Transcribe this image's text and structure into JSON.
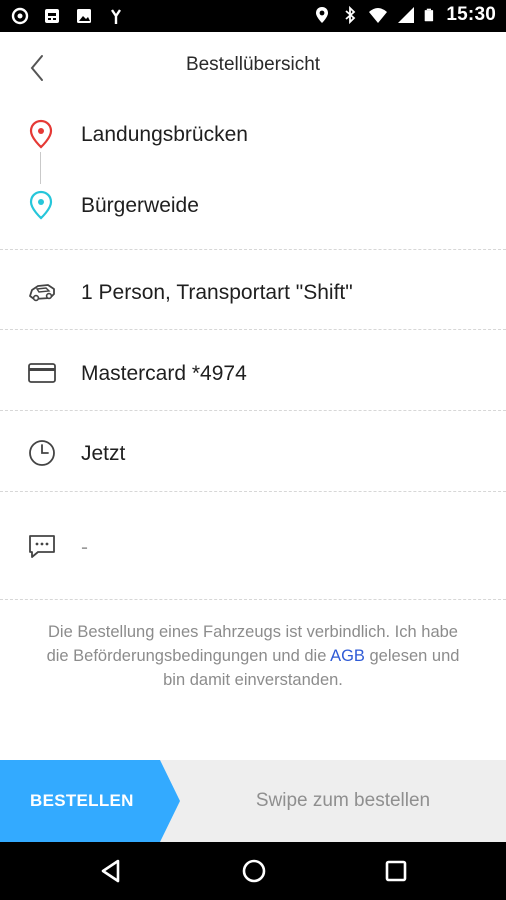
{
  "status_bar": {
    "time": "15:30",
    "left_icons": [
      "location-badge-icon",
      "sim-icon",
      "image-icon",
      "signal-fork-icon"
    ],
    "right_icons": [
      "location-pin-icon",
      "bluetooth-icon",
      "wifi-icon",
      "cellular-icon",
      "battery-icon"
    ]
  },
  "header": {
    "title": "Bestellübersicht"
  },
  "route": {
    "pickup": "Landungsbrücken",
    "destination": "Bürgerweide",
    "pickup_color": "#e53935",
    "destination_color": "#26c6da"
  },
  "details": {
    "transport": "1 Person, Transportart \"Shift\"",
    "payment": "Mastercard *4974",
    "time": "Jetzt",
    "comment": "-"
  },
  "notice": {
    "text_before_link": "Die Bestellung eines Fahrzeugs ist verbindlich. Ich habe die Beförderungsbedingungen und die ",
    "link": "AGB",
    "text_after_link": " gelesen und bin damit einverstanden."
  },
  "swipe": {
    "button_label": "BESTELLEN",
    "hint": "Swipe zum bestellen",
    "accent_color": "#33aaff"
  }
}
